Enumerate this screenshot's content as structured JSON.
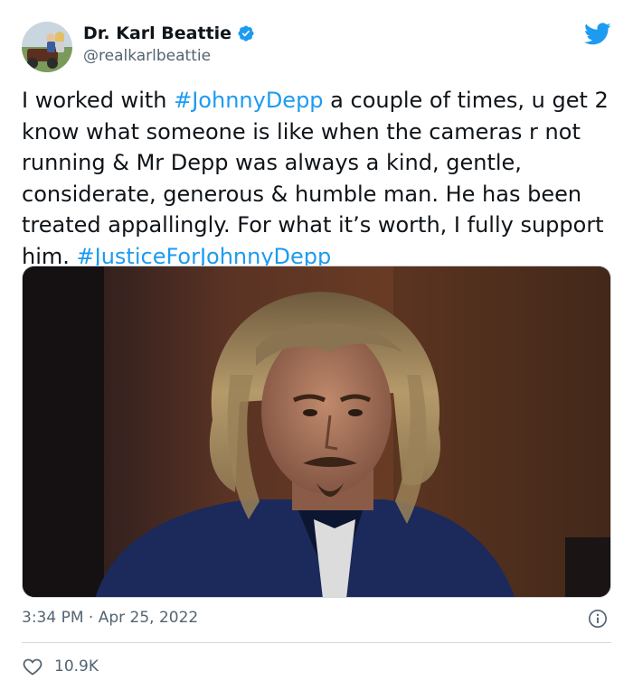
{
  "author": {
    "name": "Dr. Karl Beattie",
    "handle": "@realkarlbeattie",
    "verified": true,
    "avatar_icon": "avatar-photo"
  },
  "tweet": {
    "segments": [
      {
        "text": "I worked with ",
        "hashtag": false
      },
      {
        "text": "#JohnnyDepp",
        "hashtag": true
      },
      {
        "text": " a couple of times, u get 2 know what someone is like when the cameras r not running & Mr Depp was always a kind, gentle, considerate, generous & humble man. He has been treated appallingly. For what it’s worth, I fully support him. ",
        "hashtag": false
      },
      {
        "text": "#JusticeForJohnnyDepp",
        "hashtag": true
      }
    ]
  },
  "meta": {
    "time": "3:34 PM",
    "separator": "·",
    "date": "Apr 25, 2022"
  },
  "engagement": {
    "likes": "10.9K"
  },
  "icons": {
    "brand": "twitter-bird-icon",
    "verified": "verified-badge-icon",
    "info": "info-icon",
    "like": "heart-icon"
  },
  "colors": {
    "text": "#0f1419",
    "secondary": "#536471",
    "accent": "#1d9bf0",
    "divider": "#cfd9de"
  }
}
